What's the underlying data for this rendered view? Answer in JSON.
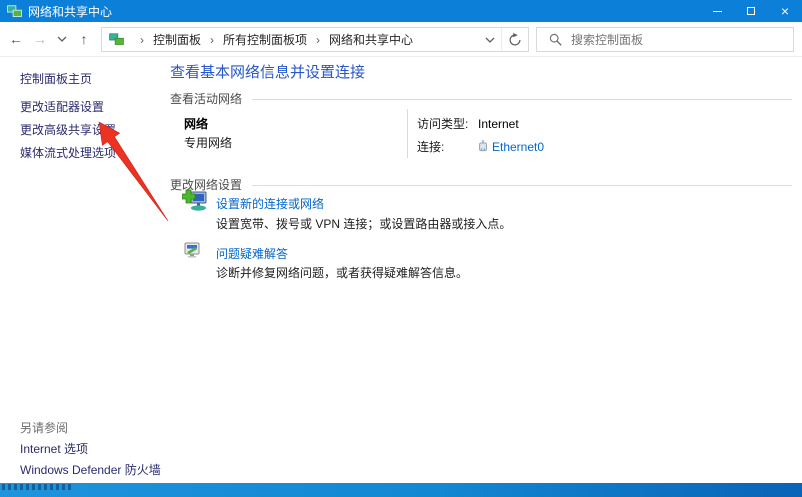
{
  "titlebar": {
    "title": "网络和共享中心"
  },
  "icons": {
    "back": "←",
    "forward": "→",
    "up": "↑",
    "breadcrumb_sep": "›",
    "close": "×"
  },
  "addressbar": {
    "breadcrumb": [
      "控制面板",
      "所有控制面板项",
      "网络和共享中心"
    ],
    "search_placeholder": "搜索控制面板"
  },
  "sidebar": {
    "home": "控制面板主页",
    "tasks": [
      "更改适配器设置",
      "更改高级共享设置",
      "媒体流式处理选项"
    ],
    "see_also": {
      "header": "另请参阅",
      "links": [
        "Internet 选项",
        "Windows Defender 防火墙"
      ]
    }
  },
  "main": {
    "heading": "查看基本网络信息并设置连接",
    "sections": {
      "active_networks": "查看活动网络",
      "change_settings": "更改网络设置"
    },
    "network": {
      "name": "网络",
      "profile": "专用网络",
      "access_label": "访问类型:",
      "access_value": "Internet",
      "connection_label": "连接:",
      "connection_value": "Ethernet0"
    },
    "tasks": [
      {
        "title": "设置新的连接或网络",
        "desc": "设置宽带、拨号或 VPN 连接；或设置路由器或接入点。"
      },
      {
        "title": "问题疑难解答",
        "desc": "诊断并修复网络问题，或者获得疑难解答信息。"
      }
    ]
  },
  "colors": {
    "titlebar": "#0c7fd9",
    "link": "#0066cc",
    "sidebar_link": "#2b2b6e",
    "heading": "#2757c8",
    "arrow": "#ec3223"
  }
}
